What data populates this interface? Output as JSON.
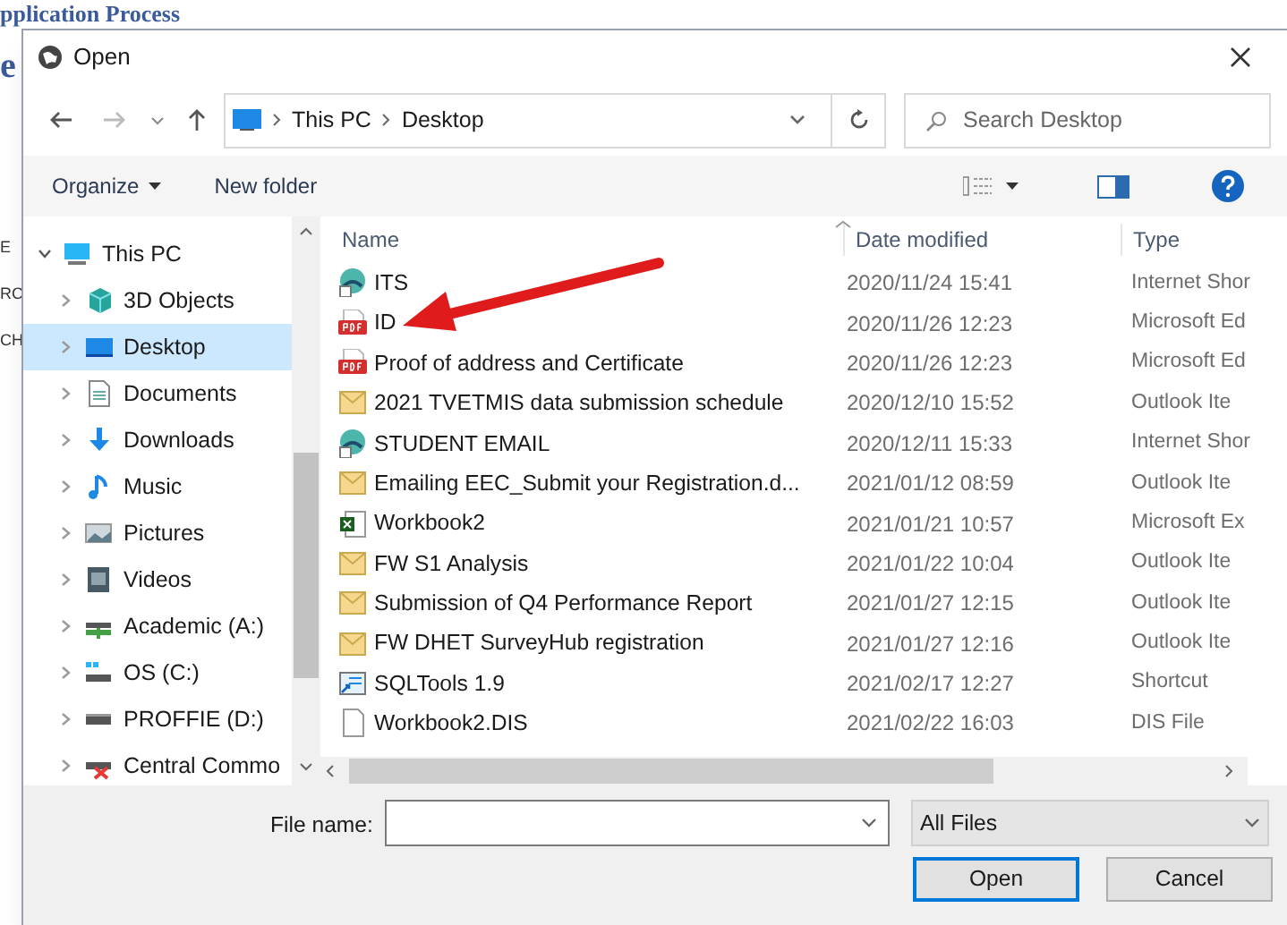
{
  "background_page": {
    "heading": "pplication Process",
    "fragment": "e",
    "side_fragments": [
      "E",
      "RC",
      "CH"
    ]
  },
  "window": {
    "title": "Open"
  },
  "address_bar": {
    "path": [
      "This PC",
      "Desktop"
    ]
  },
  "search": {
    "placeholder": "Search Desktop"
  },
  "toolbar": {
    "organize": "Organize",
    "new_folder": "New folder"
  },
  "sidebar": {
    "items": [
      {
        "label": "This PC",
        "kind": "pc",
        "expanded": true,
        "selected": false,
        "children": [
          {
            "label": "3D Objects",
            "kind": "cube",
            "expanded": false,
            "selected": false
          },
          {
            "label": "Desktop",
            "kind": "desktop",
            "expanded": false,
            "selected": true
          },
          {
            "label": "Documents",
            "kind": "documents",
            "expanded": false,
            "selected": false
          },
          {
            "label": "Downloads",
            "kind": "downloads",
            "expanded": false,
            "selected": false
          },
          {
            "label": "Music",
            "kind": "music",
            "expanded": false,
            "selected": false
          },
          {
            "label": "Pictures",
            "kind": "pictures",
            "expanded": false,
            "selected": false
          },
          {
            "label": "Videos",
            "kind": "videos",
            "expanded": false,
            "selected": false
          },
          {
            "label": "Academic (A:)",
            "kind": "netdrive",
            "expanded": false,
            "selected": false
          },
          {
            "label": "OS (C:)",
            "kind": "osdrive",
            "expanded": false,
            "selected": false
          },
          {
            "label": "PROFFIE (D:)",
            "kind": "drive",
            "expanded": false,
            "selected": false
          },
          {
            "label": "Central Commo",
            "kind": "baddrive",
            "expanded": false,
            "selected": false
          }
        ]
      }
    ]
  },
  "table": {
    "columns": [
      "Name",
      "Date modified",
      "Type"
    ],
    "rows": [
      {
        "name": "ITS",
        "date": "2020/11/24 15:41",
        "type": "Internet Shor",
        "kind": "web"
      },
      {
        "name": "ID",
        "date": "2020/11/26 12:23",
        "type": "Microsoft Ed",
        "kind": "pdf"
      },
      {
        "name": "Proof of address and Certificate",
        "date": "2020/11/26 12:23",
        "type": "Microsoft Ed",
        "kind": "pdf"
      },
      {
        "name": "2021 TVETMIS data submission schedule",
        "date": "2020/12/10 15:52",
        "type": "Outlook Ite",
        "kind": "mail"
      },
      {
        "name": "STUDENT EMAIL",
        "date": "2020/12/11 15:33",
        "type": "Internet Shor",
        "kind": "web"
      },
      {
        "name": "Emailing EEC_Submit your Registration.d...",
        "date": "2021/01/12 08:59",
        "type": "Outlook Ite",
        "kind": "mail"
      },
      {
        "name": "Workbook2",
        "date": "2021/01/21 10:57",
        "type": "Microsoft Ex",
        "kind": "excel"
      },
      {
        "name": "FW S1 Analysis",
        "date": "2021/01/22 10:04",
        "type": "Outlook Ite",
        "kind": "mail"
      },
      {
        "name": "Submission of  Q4 Performance Report",
        "date": "2021/01/27 12:15",
        "type": "Outlook Ite",
        "kind": "mail"
      },
      {
        "name": "FW DHET SurveyHub registration",
        "date": "2021/01/27 12:16",
        "type": "Outlook Ite",
        "kind": "mail"
      },
      {
        "name": "SQLTools 1.9",
        "date": "2021/02/17 12:27",
        "type": "Shortcut",
        "kind": "shortcut"
      },
      {
        "name": "Workbook2.DIS",
        "date": "2021/02/22 16:03",
        "type": "DIS File",
        "kind": "file"
      }
    ]
  },
  "footer": {
    "file_name_label": "File name:",
    "filter": "All Files",
    "buttons": [
      "Open",
      "Cancel"
    ]
  }
}
